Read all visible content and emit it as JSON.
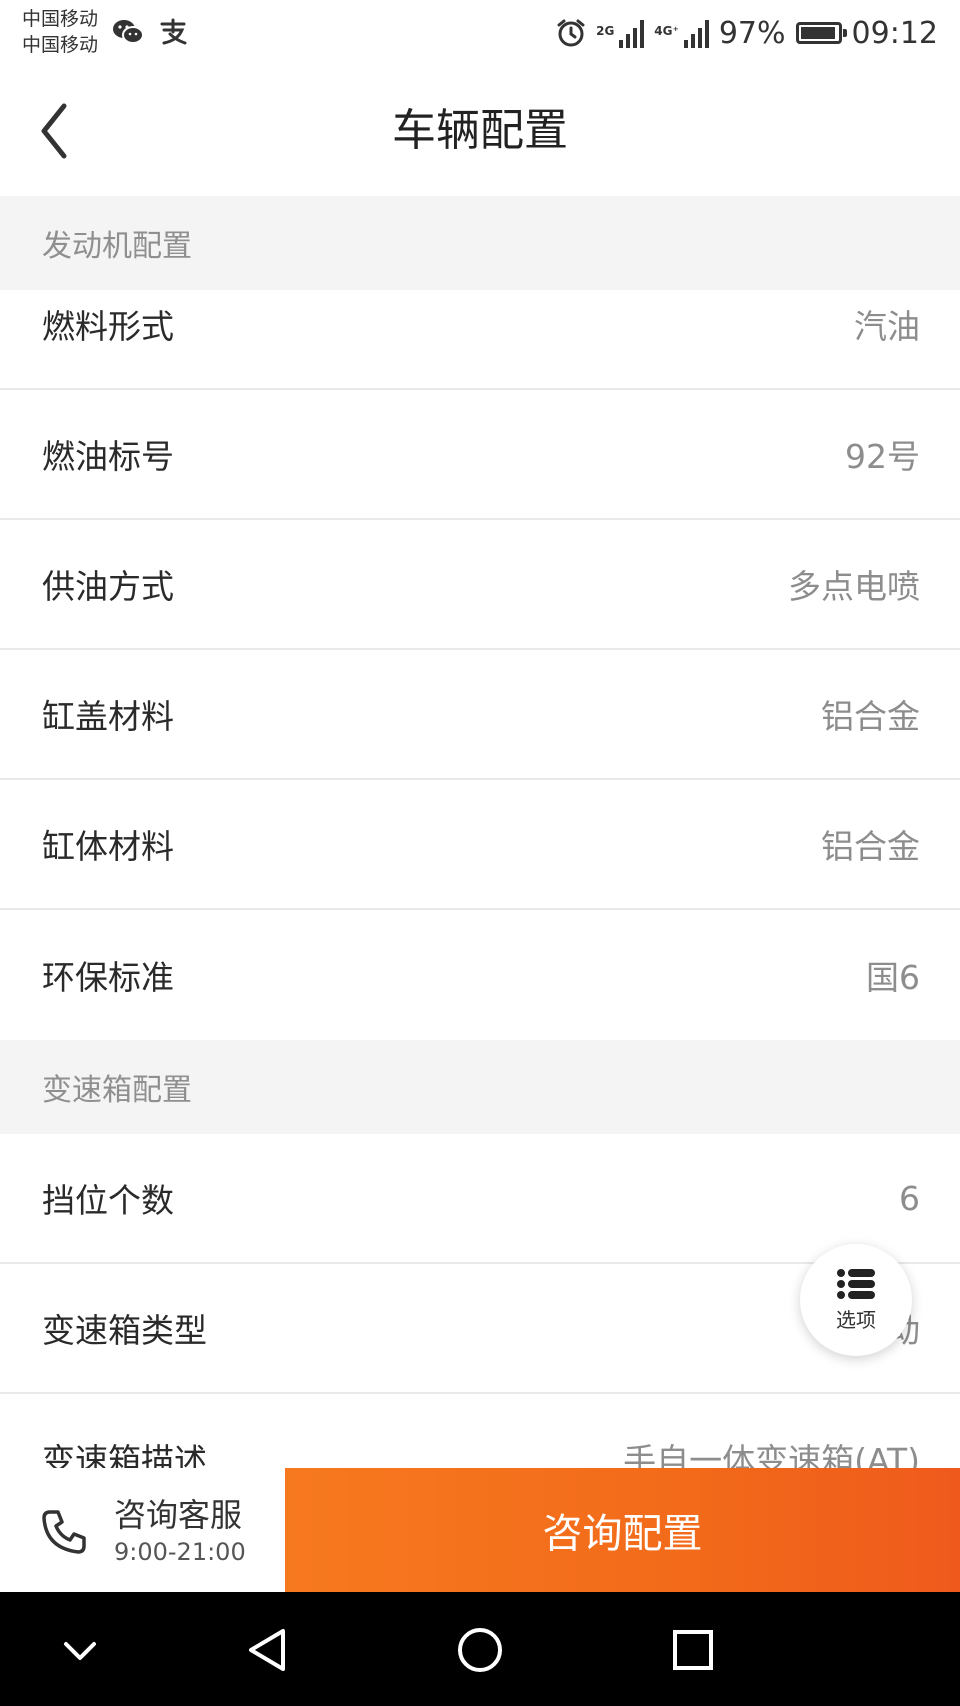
{
  "status_bar": {
    "carrier_1": "中国移动",
    "carrier_2": "中国移动",
    "app_icons": [
      "wechat-icon",
      "alipay-icon"
    ],
    "alarm_icon": "alarm-icon",
    "network_1": "2G",
    "network_2": "4G⁺",
    "battery_percent": "97%",
    "battery_level": 0.97,
    "time": "09:12"
  },
  "nav": {
    "title": "车辆配置",
    "back_icon": "chevron-left-icon"
  },
  "sections": [
    {
      "title": "发动机配置",
      "rows": [
        {
          "label": "燃料形式",
          "value": "汽油"
        },
        {
          "label": "燃油标号",
          "value": "92号"
        },
        {
          "label": "供油方式",
          "value": "多点电喷"
        },
        {
          "label": "缸盖材料",
          "value": "铝合金"
        },
        {
          "label": "缸体材料",
          "value": "铝合金"
        },
        {
          "label": "环保标准",
          "value": "国6"
        }
      ]
    },
    {
      "title": "变速箱配置",
      "rows": [
        {
          "label": "挡位个数",
          "value": "6"
        },
        {
          "label": "变速箱类型",
          "value": "自动"
        },
        {
          "label": "变速箱描述",
          "value": "手自一体变速箱(AT)"
        }
      ]
    }
  ],
  "fab": {
    "label": "选项",
    "icon": "list-icon"
  },
  "action_bar": {
    "service_title": "咨询客服",
    "service_hours": "9:00-21:00",
    "phone_icon": "phone-icon",
    "consult_label": "咨询配置"
  },
  "colors": {
    "accent": "#f26a1a",
    "section_bg": "#f4f4f4",
    "value_text": "#8d8d8d"
  }
}
